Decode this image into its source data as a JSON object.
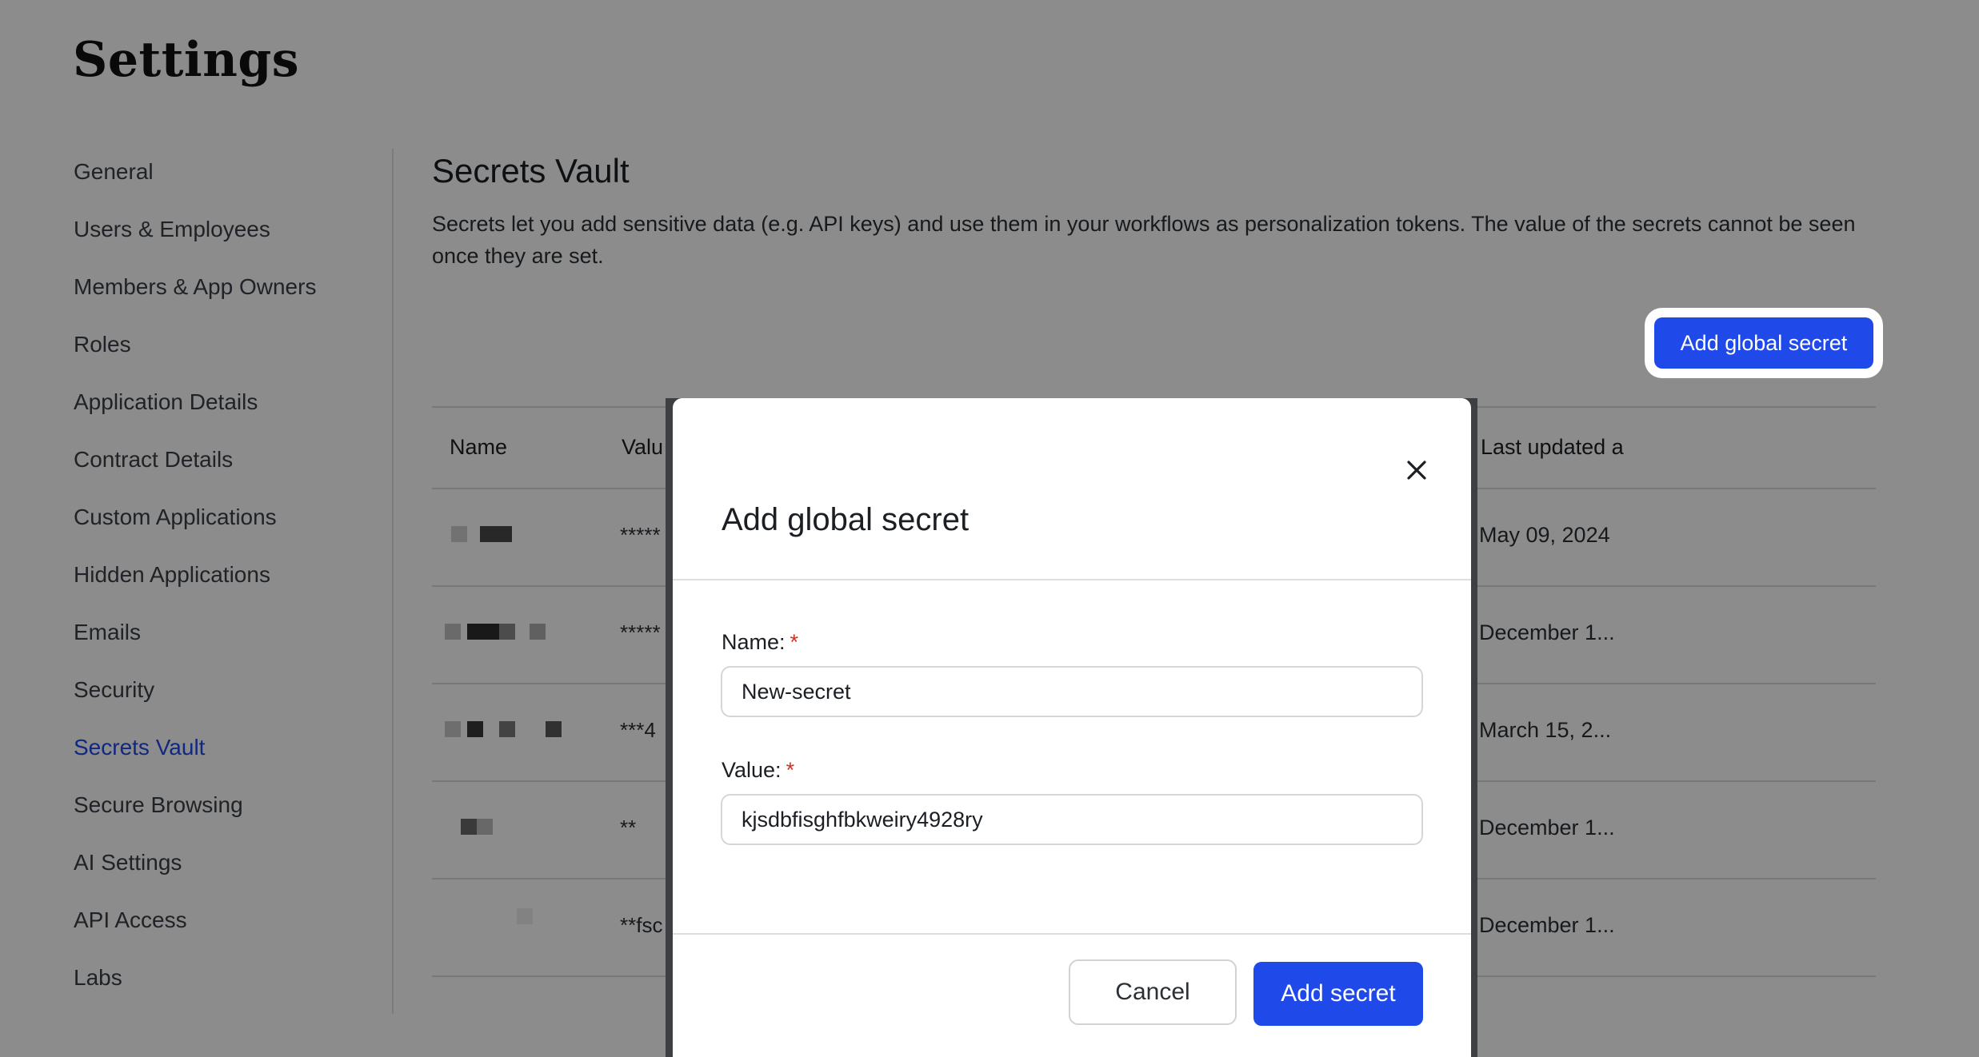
{
  "page": {
    "title": "Settings"
  },
  "sidebar": {
    "items": [
      {
        "label": "General"
      },
      {
        "label": "Users & Employees"
      },
      {
        "label": "Members & App Owners"
      },
      {
        "label": "Roles"
      },
      {
        "label": "Application Details"
      },
      {
        "label": "Contract Details"
      },
      {
        "label": "Custom Applications"
      },
      {
        "label": "Hidden Applications"
      },
      {
        "label": "Emails"
      },
      {
        "label": "Security"
      },
      {
        "label": "Secrets Vault",
        "active": true
      },
      {
        "label": "Secure Browsing"
      },
      {
        "label": "AI Settings"
      },
      {
        "label": "API Access"
      },
      {
        "label": "Labs"
      }
    ]
  },
  "secrets": {
    "title": "Secrets Vault",
    "description": "Secrets let you add sensitive data (e.g. API keys) and use them in your workflows as personalization tokens. The value of the secrets cannot be seen once they are set.",
    "add_button": "Add global secret",
    "table": {
      "columns": {
        "name": "Name",
        "value": "Valu",
        "updated": "Last updated a"
      },
      "rows": [
        {
          "value": "*****",
          "updated": "May 09, 2024"
        },
        {
          "value": "*****",
          "updated": "December 1..."
        },
        {
          "value": "***4",
          "updated": "March 15, 2..."
        },
        {
          "value": "**",
          "updated": "December 1..."
        },
        {
          "value": "**fsc",
          "updated": "December 1..."
        }
      ]
    }
  },
  "modal": {
    "title": "Add global secret",
    "name_label": "Name:",
    "name_value": "New-secret",
    "value_label": "Value:",
    "value_value": "kjsdbfisghfbkweiry4928ry",
    "required_mark": "*",
    "cancel": "Cancel",
    "submit": "Add secret"
  },
  "colors": {
    "accent": "#1f49e8",
    "required": "#d92d20"
  }
}
